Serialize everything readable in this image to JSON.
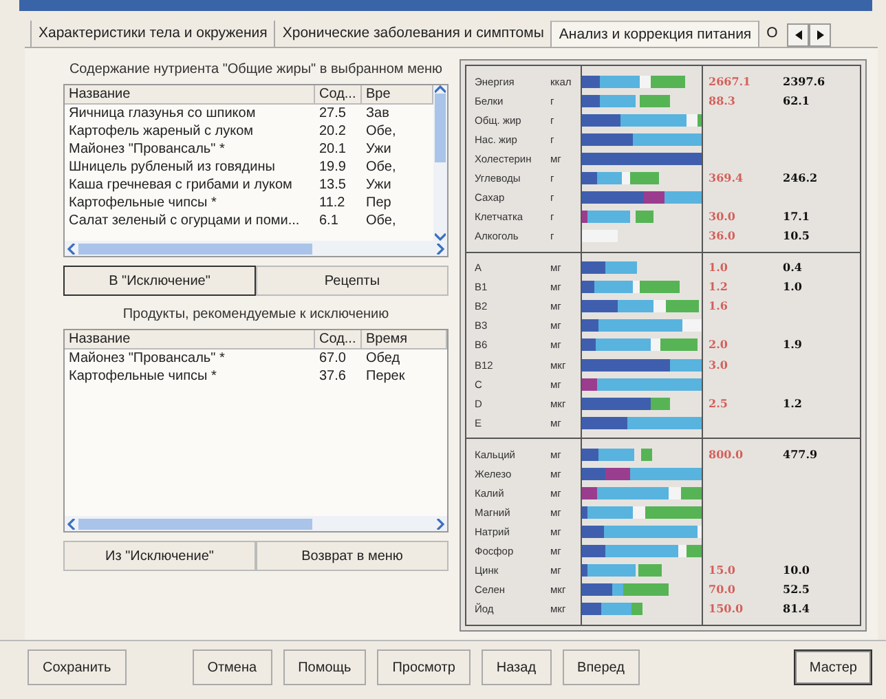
{
  "tabs": [
    {
      "label": "Характеристики тела и окружения",
      "selected": false
    },
    {
      "label": "Хронические заболевания и симптомы",
      "selected": false
    },
    {
      "label": "Анализ и коррекция питания",
      "selected": true
    },
    {
      "label": "О",
      "selected": false
    }
  ],
  "menu_panel": {
    "heading": "Содержание нутриента \"Общие жиры\" в выбранном меню",
    "columns": [
      "Название",
      "Сод...",
      "Вре"
    ],
    "rows": [
      [
        "Яичница глазунья со шпиком",
        "27.5",
        "Зав"
      ],
      [
        "Картофель жареный с луком",
        "20.2",
        "Обе,"
      ],
      [
        "Майонез \"Провансаль\" *",
        "20.1",
        "Ужи"
      ],
      [
        "Шницель рубленый из говядины",
        "19.9",
        "Обе,"
      ],
      [
        "Каша гречневая с грибами и луком",
        "13.5",
        "Ужи"
      ],
      [
        "Картофельные чипсы *",
        "11.2",
        "Пер"
      ],
      [
        "Салат зеленый с огурцами и поми...",
        "6.1",
        "Обе,"
      ]
    ],
    "buttons": [
      "В \"Исключение\"",
      "Рецепты"
    ]
  },
  "exclusion_panel": {
    "heading": "Продукты, рекомендуемые к исключению",
    "columns": [
      "Название",
      "Сод...",
      "Время"
    ],
    "rows": [
      [
        "Майонез \"Провансаль\" *",
        "67.0",
        "Обед"
      ],
      [
        "Картофельные чипсы *",
        "37.6",
        "Перек"
      ]
    ],
    "buttons": [
      "Из \"Исключение\"",
      "Возврат в меню"
    ]
  },
  "nutrient_groups": [
    {
      "rows": [
        {
          "name": "Энергия",
          "unit": "ккал",
          "norm": "2667.1",
          "actual": "2397.6",
          "excess": false
        },
        {
          "name": "Белки",
          "unit": "г",
          "norm": "88.3",
          "actual": "62.1",
          "excess": false
        },
        {
          "name": "Общ. жир",
          "unit": "г"
        },
        {
          "name": "Нас. жир",
          "unit": "г"
        },
        {
          "name": "Холестерин",
          "unit": "мг"
        },
        {
          "name": "Углеводы",
          "unit": "г",
          "norm": "369.4",
          "actual": "246.2",
          "excess": false
        },
        {
          "name": "Сахар",
          "unit": "г"
        },
        {
          "name": "Клетчатка",
          "unit": "г",
          "norm": "30.0",
          "actual": "17.1",
          "excess": false
        },
        {
          "name": "Алкоголь",
          "unit": "г",
          "norm": "36.0",
          "actual": "10.5",
          "excess": false
        }
      ]
    },
    {
      "rows": [
        {
          "name": "A",
          "unit": "мг",
          "norm": "1.0",
          "actual": "0.4",
          "excess": false
        },
        {
          "name": "B1",
          "unit": "мг",
          "norm": "1.2",
          "actual": "1.0",
          "excess": false
        },
        {
          "name": "B2",
          "unit": "мг",
          "norm": "1.6"
        },
        {
          "name": "B3",
          "unit": "мг"
        },
        {
          "name": "B6",
          "unit": "мг",
          "norm": "2.0",
          "actual": "1.9",
          "excess": false
        },
        {
          "name": "B12",
          "unit": "мкг",
          "norm": "3.0"
        },
        {
          "name": "C",
          "unit": "мг"
        },
        {
          "name": "D",
          "unit": "мкг",
          "norm": "2.5",
          "actual": "1.2",
          "excess": false
        },
        {
          "name": "E",
          "unit": "мг"
        }
      ]
    },
    {
      "rows": [
        {
          "name": "Кальций",
          "unit": "мг",
          "norm": "800.0",
          "actual": "477.9",
          "excess": false
        },
        {
          "name": "Железо",
          "unit": "мг"
        },
        {
          "name": "Калий",
          "unit": "мг"
        },
        {
          "name": "Магний",
          "unit": "мг"
        },
        {
          "name": "Натрий",
          "unit": "мг"
        },
        {
          "name": "Фосфор",
          "unit": "мг"
        },
        {
          "name": "Цинк",
          "unit": "мг",
          "norm": "15.0",
          "actual": "10.0",
          "excess": false
        },
        {
          "name": "Селен",
          "unit": "мкг",
          "norm": "70.0",
          "actual": "52.5",
          "excess": false
        },
        {
          "name": "Йод",
          "unit": "мкг",
          "norm": "150.0",
          "actual": "81.4",
          "excess": false
        }
      ]
    }
  ],
  "footer_buttons": [
    {
      "label": "Сохранить",
      "default": false
    },
    {
      "label": "Отмена",
      "default": false
    },
    {
      "label": "Помощь",
      "default": false
    },
    {
      "label": "Просмотр",
      "default": false
    },
    {
      "label": "Назад",
      "default": false
    },
    {
      "label": "Вперед",
      "default": false
    },
    {
      "label": "Мастер",
      "default": true
    }
  ]
}
